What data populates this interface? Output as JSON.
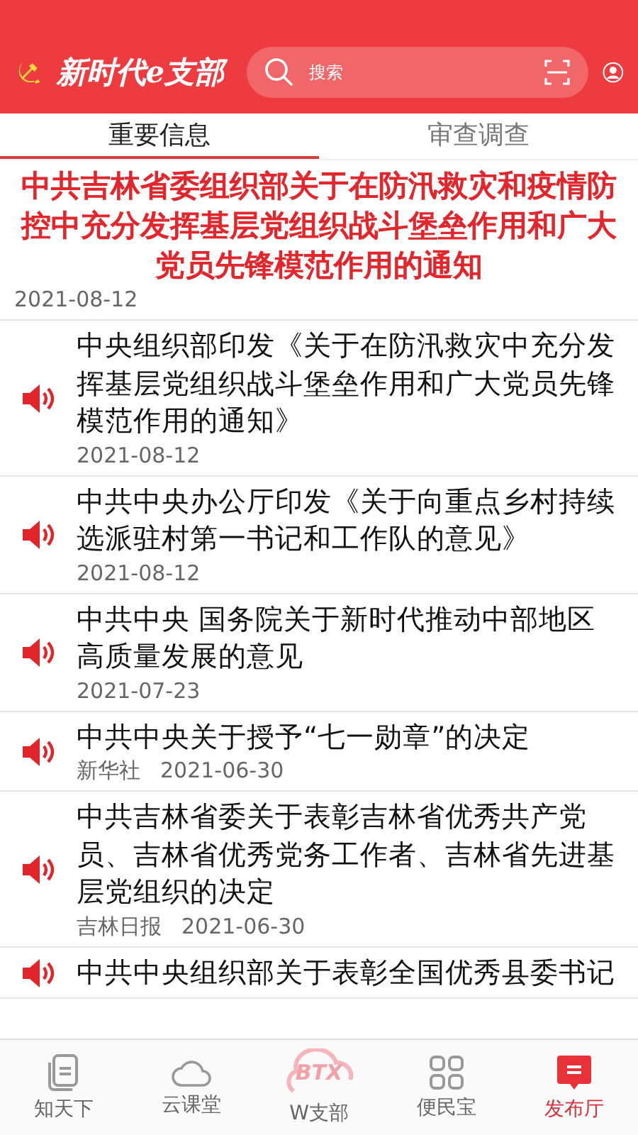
{
  "header": {
    "app_name": "新时代e支部",
    "search": {
      "placeholder": "搜索"
    }
  },
  "tabs": [
    {
      "label": "重要信息",
      "selected": true
    },
    {
      "label": "审查调查",
      "selected": false
    }
  ],
  "featured": {
    "title": "中共吉林省委组织部关于在防汛救灾和疫情防控中充分发挥基层党组织战斗堡垒作用和广大党员先锋模范作用的通知",
    "date": "2021-08-12"
  },
  "articles": [
    {
      "title": "中央组织部印发《关于在防汛救灾中充分发挥基层党组织战斗堡垒作用和广大党员先锋模范作用的通知》",
      "date": "2021-08-12"
    },
    {
      "title": "中共中央办公厅印发《关于向重点乡村持续选派驻村第一书记和工作队的意见》",
      "date": "2021-08-12"
    },
    {
      "title": "中共中央 国务院关于新时代推动中部地区高质量发展的意见",
      "date": "2021-07-23"
    },
    {
      "title": "中共中央关于授予“七一勋章”的决定",
      "source": "新华社",
      "date": "2021-06-30"
    },
    {
      "title": "中共吉林省委关于表彰吉林省优秀共产党员、吉林省优秀党务工作者、吉林省先进基层党组织的决定",
      "source": "吉林日报",
      "date": "2021-06-30"
    },
    {
      "title": "中共中央组织部关于表彰全国优秀县委书记"
    }
  ],
  "nav": [
    {
      "label": "知天下",
      "kind": "doc",
      "selected": false
    },
    {
      "label": "云课堂",
      "kind": "cloud",
      "selected": false
    },
    {
      "label": "W支部",
      "kind": "logo",
      "logo_text": "BTX",
      "selected": false
    },
    {
      "label": "便民宝",
      "kind": "grid",
      "selected": false
    },
    {
      "label": "发布厅",
      "kind": "chat",
      "selected": true
    }
  ]
}
